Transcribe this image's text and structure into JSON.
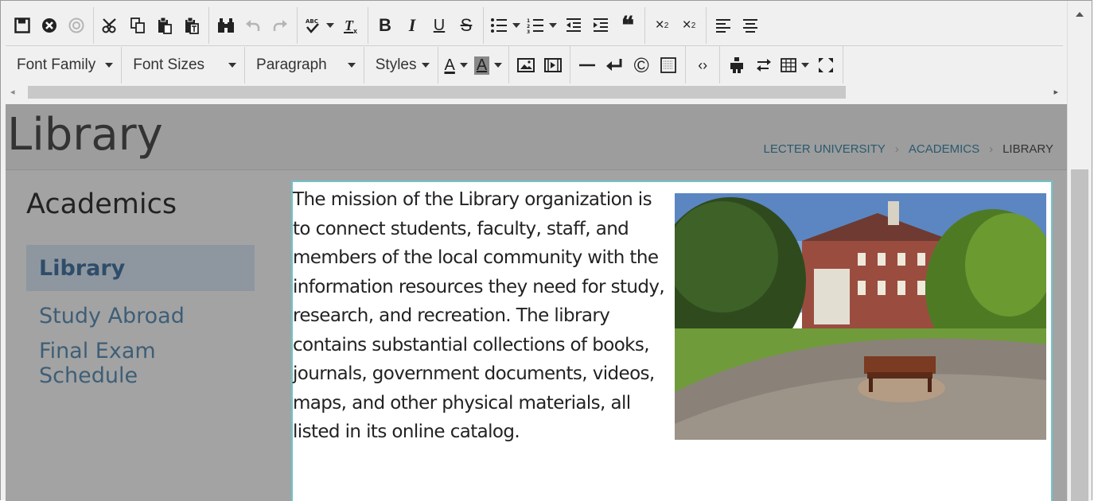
{
  "toolbar": {
    "font_family": "Font Family",
    "font_sizes": "Font Sizes",
    "paragraph": "Paragraph",
    "styles": "Styles"
  },
  "page": {
    "title": "Library",
    "breadcrumb": [
      "LECTER UNIVERSITY",
      "ACADEMICS",
      "LIBRARY"
    ],
    "breadcrumb_sep": "›"
  },
  "sidenav": {
    "heading": "Academics",
    "items": [
      {
        "label": "Library",
        "active": true
      },
      {
        "label": "Study Abroad",
        "active": false
      },
      {
        "label": "Final Exam Schedule",
        "active": false
      }
    ]
  },
  "content": {
    "text": "The mission of the Library organization is to connect students, faculty, staff, and members of the local community with the information resources they need for study, research, and recreation. The library contains substantial collections of books, journals, government documents, videos, maps, and other physical materials, all listed in its online catalog."
  },
  "colors": {
    "page_bg": "#a3a3a3",
    "editor_border": "#6ec4c9",
    "link": "#2a5a6e",
    "nav_text": "#3e5e77"
  }
}
